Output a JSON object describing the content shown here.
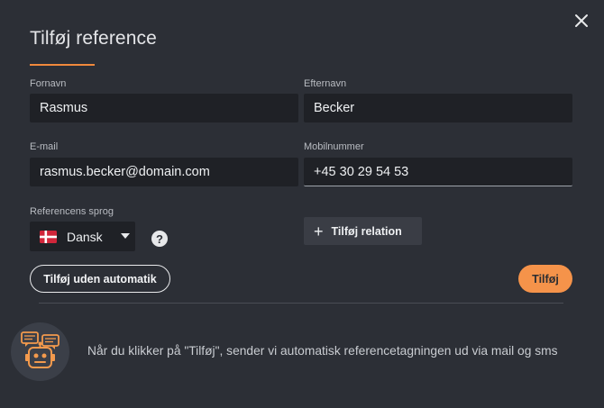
{
  "dialog": {
    "title": "Tilføj reference",
    "accent_color": "#f0893c"
  },
  "form": {
    "first_name": {
      "label": "Fornavn",
      "value": "Rasmus"
    },
    "last_name": {
      "label": "Efternavn",
      "value": "Becker"
    },
    "email": {
      "label": "E-mail",
      "value": "rasmus.becker@domain.com"
    },
    "mobile": {
      "label": "Mobilnummer",
      "value": "+45 30 29 54 53"
    },
    "language": {
      "label": "Referencens sprog",
      "selected": "Dansk",
      "flag": "denmark-flag"
    }
  },
  "actions": {
    "add_relation": "Tilføj relation",
    "add_without_automation": "Tilføj uden automatik",
    "add": "Tilføj"
  },
  "help": {
    "symbol": "?"
  },
  "info": {
    "text": "Når du klikker på \"Tilføj\", sender vi automatisk referencetagningen ud via mail og sms",
    "icon": "robot-chat-icon"
  }
}
